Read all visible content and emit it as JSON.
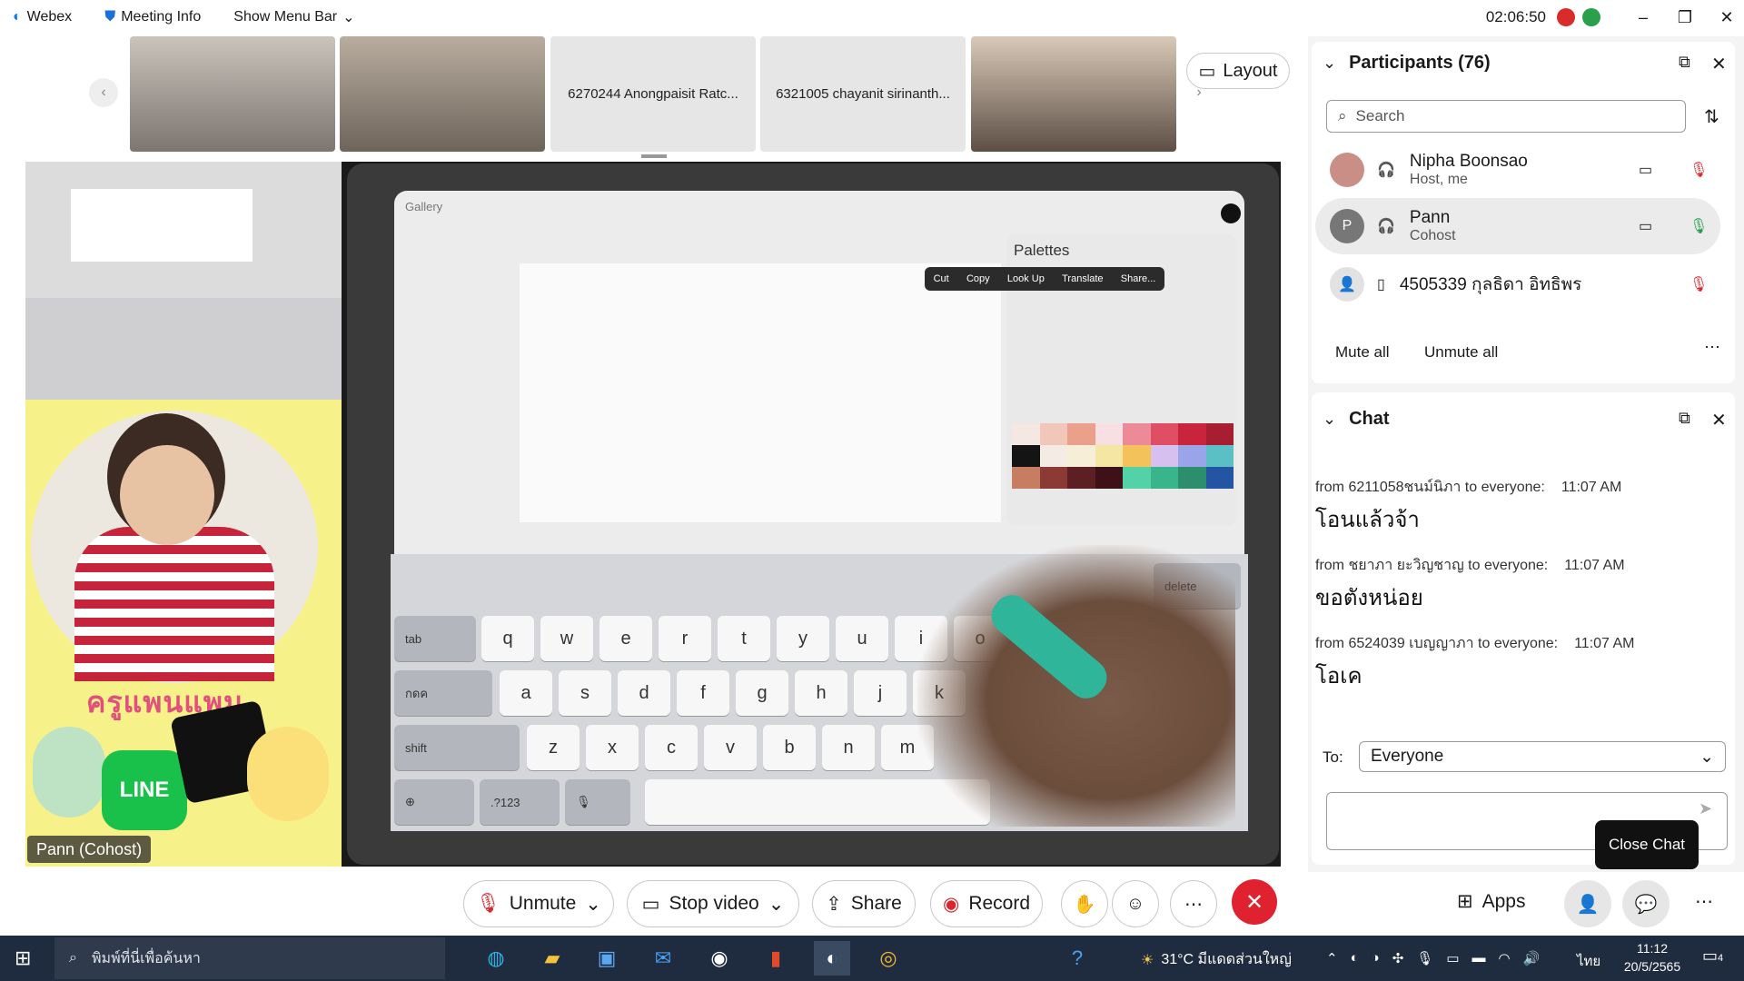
{
  "titlebar": {
    "app_name": "Webex",
    "meeting_info": "Meeting Info",
    "show_menu_bar": "Show Menu Bar",
    "time": "02:06:50"
  },
  "thumbnails": [
    {
      "label": ""
    },
    {
      "label": ""
    },
    {
      "label": "6270244 Anongpaisit Ratc..."
    },
    {
      "label": "6321005 chayanit sirinanth..."
    },
    {
      "label": ""
    }
  ],
  "layout_button": "Layout",
  "stage": {
    "procreate": {
      "gallery": "Gallery",
      "palettes_title": "Palettes",
      "context_menu": [
        "Cut",
        "Copy",
        "Look Up",
        "Translate",
        "Share..."
      ],
      "keyboard_rows": [
        [
          "q",
          "w",
          "e",
          "r",
          "t",
          "y",
          "u",
          "i",
          "o"
        ],
        [
          "a",
          "s",
          "d",
          "f",
          "g",
          "h",
          "j",
          "k"
        ],
        [
          "z",
          "x",
          "c",
          "v",
          "b",
          "n",
          "m"
        ]
      ],
      "key_tab": "tab",
      "key_shift": "shift",
      "key_delete": "delete",
      "key_123": ".?123",
      "key_caps": "กดค"
    },
    "presenter": {
      "title": "ครูแพนแพม",
      "line_label": "LINE",
      "name_tag": "Pann (Cohost)"
    }
  },
  "participants": {
    "title": "Participants (76)",
    "search_placeholder": "Search",
    "list": [
      {
        "name": "Nipha Boonsao",
        "role": "Host, me",
        "initial": ""
      },
      {
        "name": "Pann",
        "role": "Cohost",
        "initial": "P"
      },
      {
        "name": "4505339 กุลธิดา อิทธิพร",
        "role": "",
        "initial": ""
      }
    ],
    "mute_all": "Mute all",
    "unmute_all": "Unmute all"
  },
  "chat": {
    "title": "Chat",
    "messages": [
      {
        "meta": "from 6211058ชนม์นิภา to everyone:",
        "time": "11:07 AM",
        "text": "โอนแล้วจ้า"
      },
      {
        "meta": "from ชยาภา ยะวิญชาญ to everyone:",
        "time": "11:07 AM",
        "text": "ขอตังหน่อย"
      },
      {
        "meta": "from 6524039 เบญญาภา to everyone:",
        "time": "11:07 AM",
        "text": "โอเค"
      }
    ],
    "to_label": "To:",
    "to_value": "Everyone",
    "tooltip": "Close Chat"
  },
  "toolbar": {
    "unmute": "Unmute",
    "stop_video": "Stop video",
    "share": "Share",
    "record": "Record",
    "apps": "Apps"
  },
  "taskbar": {
    "search_placeholder": "พิมพ์ที่นี่เพื่อค้นหา",
    "weather": "31°C มีแดดส่วนใหญ่",
    "lang": "ไทย",
    "clock_time": "11:12",
    "clock_date": "20/5/2565",
    "notif_count": "4"
  }
}
